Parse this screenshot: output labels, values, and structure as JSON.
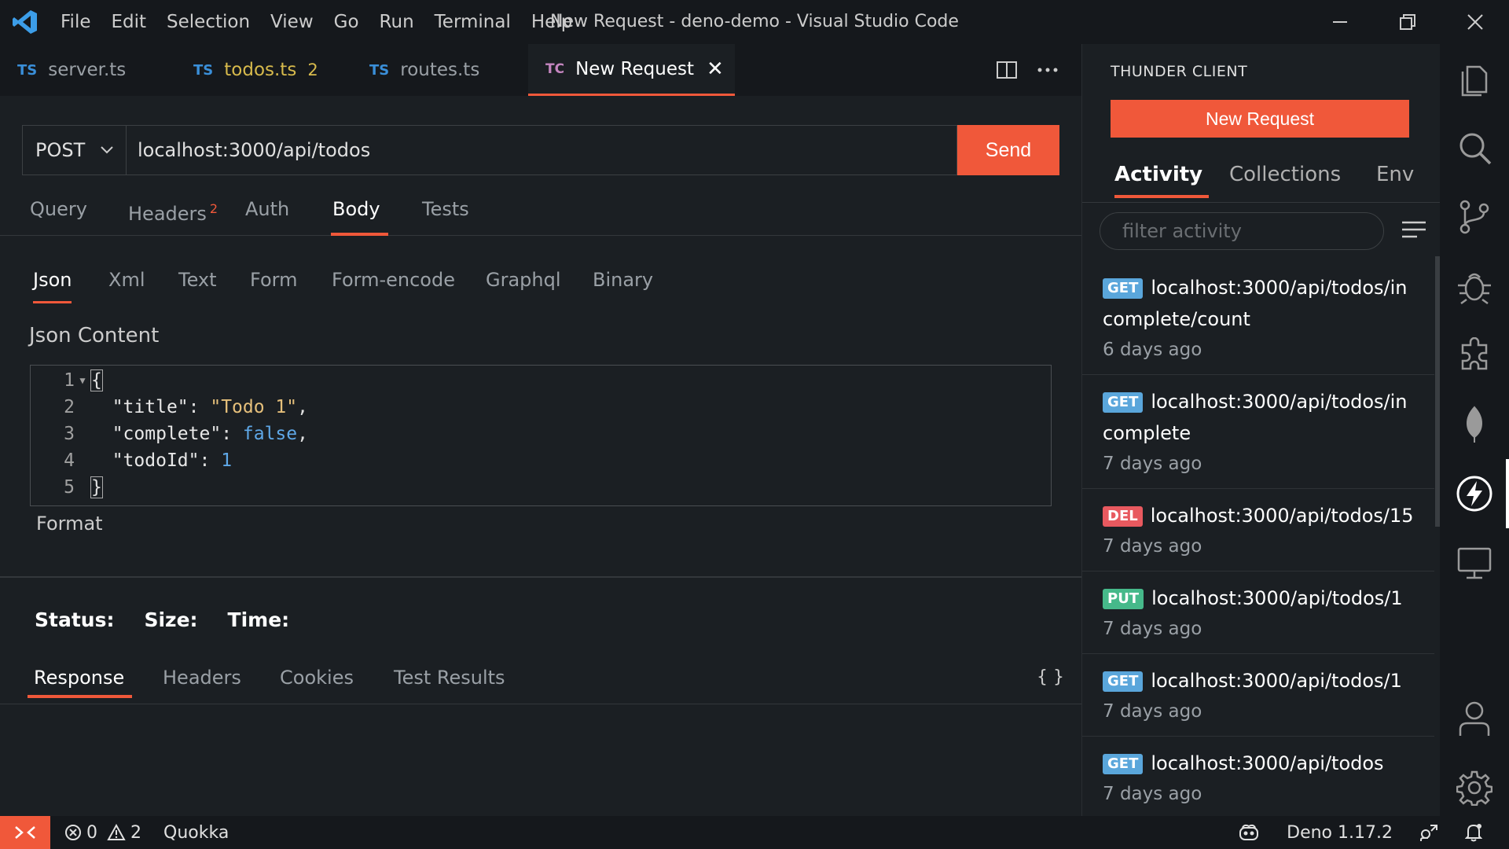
{
  "window": {
    "title": "New Request - deno-demo - Visual Studio Code"
  },
  "menu": [
    "File",
    "Edit",
    "Selection",
    "View",
    "Go",
    "Run",
    "Terminal",
    "Help"
  ],
  "tabs": [
    {
      "badge": "TS",
      "label": "server.ts"
    },
    {
      "badge": "TS",
      "label": "todos.ts",
      "count": "2"
    },
    {
      "badge": "TS",
      "label": "routes.ts"
    },
    {
      "badge": "TC",
      "label": "New Request"
    }
  ],
  "request": {
    "method": "POST",
    "url": "localhost:3000/api/todos",
    "send_label": "Send",
    "tabs": [
      "Query",
      "Headers",
      "Auth",
      "Body",
      "Tests"
    ],
    "headers_count": "2",
    "active_tab": "Body"
  },
  "body": {
    "tabs": [
      "Json",
      "Xml",
      "Text",
      "Form",
      "Form-encode",
      "Graphql",
      "Binary"
    ],
    "active_tab": "Json",
    "content_label": "Json Content",
    "format_label": "Format",
    "line_numbers": [
      "1",
      "2",
      "3",
      "4",
      "5"
    ],
    "code": {
      "l1": "{",
      "k_title": "\"title\"",
      "v_title": "\"Todo 1\"",
      "k_complete": "\"complete\"",
      "v_complete": "false",
      "k_todoId": "\"todoId\"",
      "v_todoId": "1",
      "l5": "}"
    }
  },
  "response": {
    "status_label": "Status:",
    "size_label": "Size:",
    "time_label": "Time:",
    "tabs": [
      "Response",
      "Headers",
      "Cookies",
      "Test Results"
    ],
    "braces": "{ }"
  },
  "thunder": {
    "title": "THUNDER CLIENT",
    "new_request": "New Request",
    "tabs": [
      "Activity",
      "Collections",
      "Env"
    ],
    "filter_placeholder": "filter activity",
    "activity": [
      {
        "method": "GET",
        "url": "localhost:3000/api/todos/incomplete/count",
        "time": "6 days ago"
      },
      {
        "method": "GET",
        "url": "localhost:3000/api/todos/incomplete",
        "time": "7 days ago"
      },
      {
        "method": "DEL",
        "url": "localhost:3000/api/todos/15",
        "time": "7 days ago"
      },
      {
        "method": "PUT",
        "url": "localhost:3000/api/todos/1",
        "time": "7 days ago"
      },
      {
        "method": "GET",
        "url": "localhost:3000/api/todos/1",
        "time": "7 days ago"
      },
      {
        "method": "GET",
        "url": "localhost:3000/api/todos",
        "time": "7 days ago"
      }
    ]
  },
  "statusbar": {
    "errors": "0",
    "warnings": "2",
    "quokka": "Quokka",
    "deno": "Deno 1.17.2"
  },
  "colors": {
    "accent": "#f0583a",
    "get": "#5aa6db",
    "del": "#e8595f",
    "put": "#46b98a"
  },
  "icons": {
    "activitybar": [
      "explorer-icon",
      "search-icon",
      "source-control-icon",
      "debug-icon",
      "extensions-icon",
      "mongodb-leaf-icon",
      "thunder-client-icon",
      "remote-explorer-icon",
      "account-icon",
      "settings-gear-icon"
    ]
  }
}
